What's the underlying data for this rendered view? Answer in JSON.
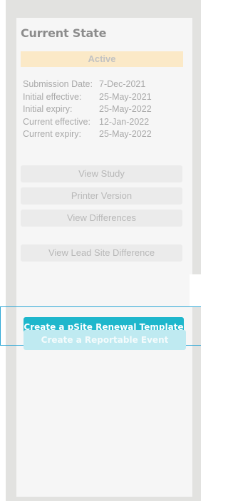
{
  "panel": {
    "title": "Current State",
    "status": "Active",
    "details": [
      {
        "label": "Submission Date:",
        "value": "7-Dec-2021"
      },
      {
        "label": "Initial effective:",
        "value": "25-May-2021"
      },
      {
        "label": "Initial expiry:",
        "value": "25-May-2022"
      },
      {
        "label": "Current effective:",
        "value": "12-Jan-2022"
      },
      {
        "label": "Current expiry:",
        "value": "25-May-2022"
      }
    ],
    "buttons": {
      "view_study": "View Study",
      "printer_version": "Printer Version",
      "view_differences": "View Differences",
      "view_lead_site_difference": "View Lead Site Difference",
      "create_psite_renewal_template": "Create a pSite Renewal Template",
      "create_reportable_event": "Create a Reportable Event"
    }
  },
  "colors": {
    "status_badge_bg": "#fbe9c7",
    "primary_button": "#1fb7cc",
    "disabled_button": "#bfeaf1",
    "highlight_outline": "#2ea7d6"
  }
}
